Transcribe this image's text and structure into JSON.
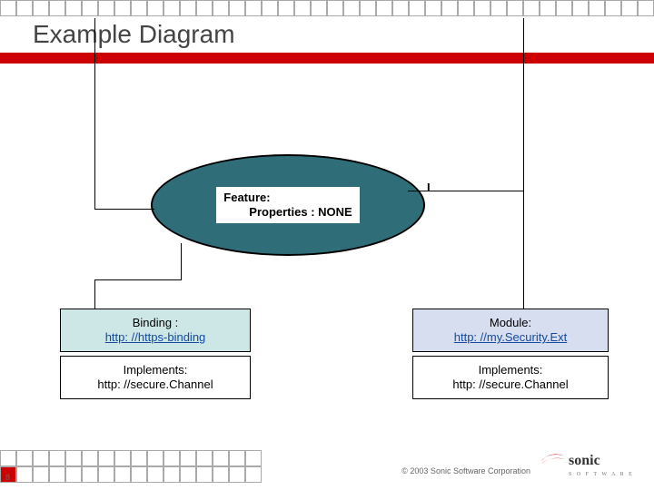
{
  "slide": {
    "title": "Example Diagram",
    "page_number": "8",
    "copyright": "© 2003 Sonic Software Corporation",
    "brand": {
      "name": "sonic",
      "tagline": "S O F T W A R E",
      "accent": "#cc0000"
    }
  },
  "diagram": {
    "feature": {
      "line1": "Feature:",
      "line2": "Properties : NONE",
      "note": "I"
    },
    "binding": {
      "label": "Binding :",
      "uri": "http: //https-binding"
    },
    "module": {
      "label": "Module:",
      "uri": "http: //my.Security.Ext"
    },
    "implements_left": {
      "label": "Implements:",
      "uri": "http: //secure.Channel"
    },
    "implements_right": {
      "label": "Implements:",
      "uri": "http: //secure.Channel"
    }
  },
  "chart_data": {
    "type": "diagram",
    "title": "Example Diagram",
    "nodes": [
      {
        "id": "feature",
        "shape": "ellipse",
        "label": "Feature: Properties : NONE"
      },
      {
        "id": "binding",
        "shape": "rect",
        "label": "Binding : http://https-binding"
      },
      {
        "id": "module",
        "shape": "rect",
        "label": "Module: http://my.Security.Ext"
      },
      {
        "id": "impl_left",
        "shape": "rect",
        "label": "Implements: http://secure.Channel"
      },
      {
        "id": "impl_right",
        "shape": "rect",
        "label": "Implements: http://secure.Channel"
      }
    ],
    "edges": [
      {
        "from": "feature",
        "to": "binding"
      },
      {
        "from": "feature",
        "to": "module"
      },
      {
        "from": "binding",
        "to": "impl_left"
      },
      {
        "from": "module",
        "to": "impl_right"
      }
    ]
  }
}
